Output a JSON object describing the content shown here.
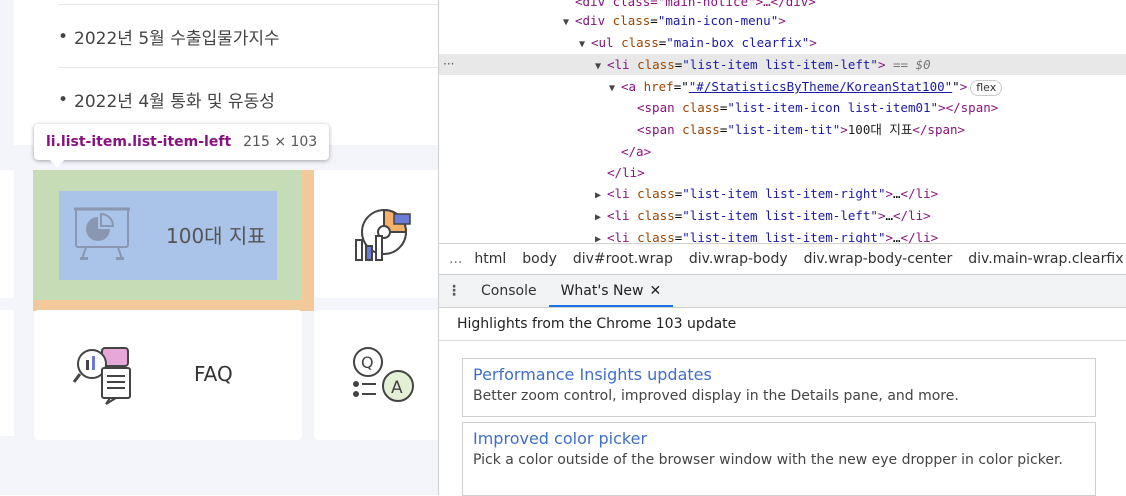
{
  "page": {
    "notices": [
      "2022년 5월 수출입물가지수",
      "2022년 4월 통화 및 유동성"
    ],
    "tiles": [
      {
        "label": "100대 지표",
        "icon": "presentation-chart-icon"
      },
      {
        "label": "",
        "icon": "stats-disc-icon"
      },
      {
        "label": "FAQ",
        "icon": "faq-chat-icon"
      },
      {
        "label": "",
        "icon": "qa-icon"
      }
    ],
    "tooltip": {
      "selector": "li.list-item.list-item-left",
      "size": "215 × 103"
    }
  },
  "devtools": {
    "lines": [
      {
        "indent": 0,
        "html": "<span class=\"tag\">&lt;div</span> <span class=\"attr\">class</span>=<span class=\"val\">\"main-notice\"</span><span class=\"tag\">&gt;</span>…<span class=\"tag\">&lt;/div&gt;</span>"
      }
    ],
    "el_l0": "<div class=\"main-notice\">…</div>",
    "el_l1_tag": "<div",
    "el_l1_attr": "class",
    "el_l1_val": "\"main-icon-menu\"",
    "el_l2_tag": "<ul",
    "el_l2_val": "\"main-box clearfix\"",
    "el_l3_tag": "<li",
    "el_l3_val": "\"list-item list-item-left\"",
    "el_l3_eq": "== $0",
    "el_l4_tag": "<a",
    "el_l4_attr": "href",
    "el_l4_val": "\"#/StatisticsByTheme/KoreanStat100\"",
    "el_l4_badge": "flex",
    "el_l5_val": "\"list-item-icon list-item01\"",
    "el_l6_val": "\"list-item-tit\"",
    "el_l6_text": "100대 지표",
    "el_l7": "</a>",
    "el_l8": "</li>",
    "el_l9_val": "\"list-item list-item-right\"",
    "el_l10_val": "\"list-item list-item-left\"",
    "el_l11_val": "\"list-item list-item-right\"",
    "breadcrumbs": [
      "html",
      "body",
      "div#root.wrap",
      "div.wrap-body",
      "div.wrap-body-center",
      "div.main-wrap.clearfix"
    ],
    "more": "...",
    "drawer": {
      "tabs": [
        "Console",
        "What's New"
      ],
      "close": "✕"
    },
    "highlights_title": "Highlights from the Chrome 103 update",
    "cards": [
      {
        "title": "Performance Insights updates",
        "desc": "Better zoom control, improved display in the Details pane, and more."
      },
      {
        "title": "Improved color picker",
        "desc": "Pick a color outside of the browser window with the new eye dropper in color picker."
      }
    ]
  }
}
